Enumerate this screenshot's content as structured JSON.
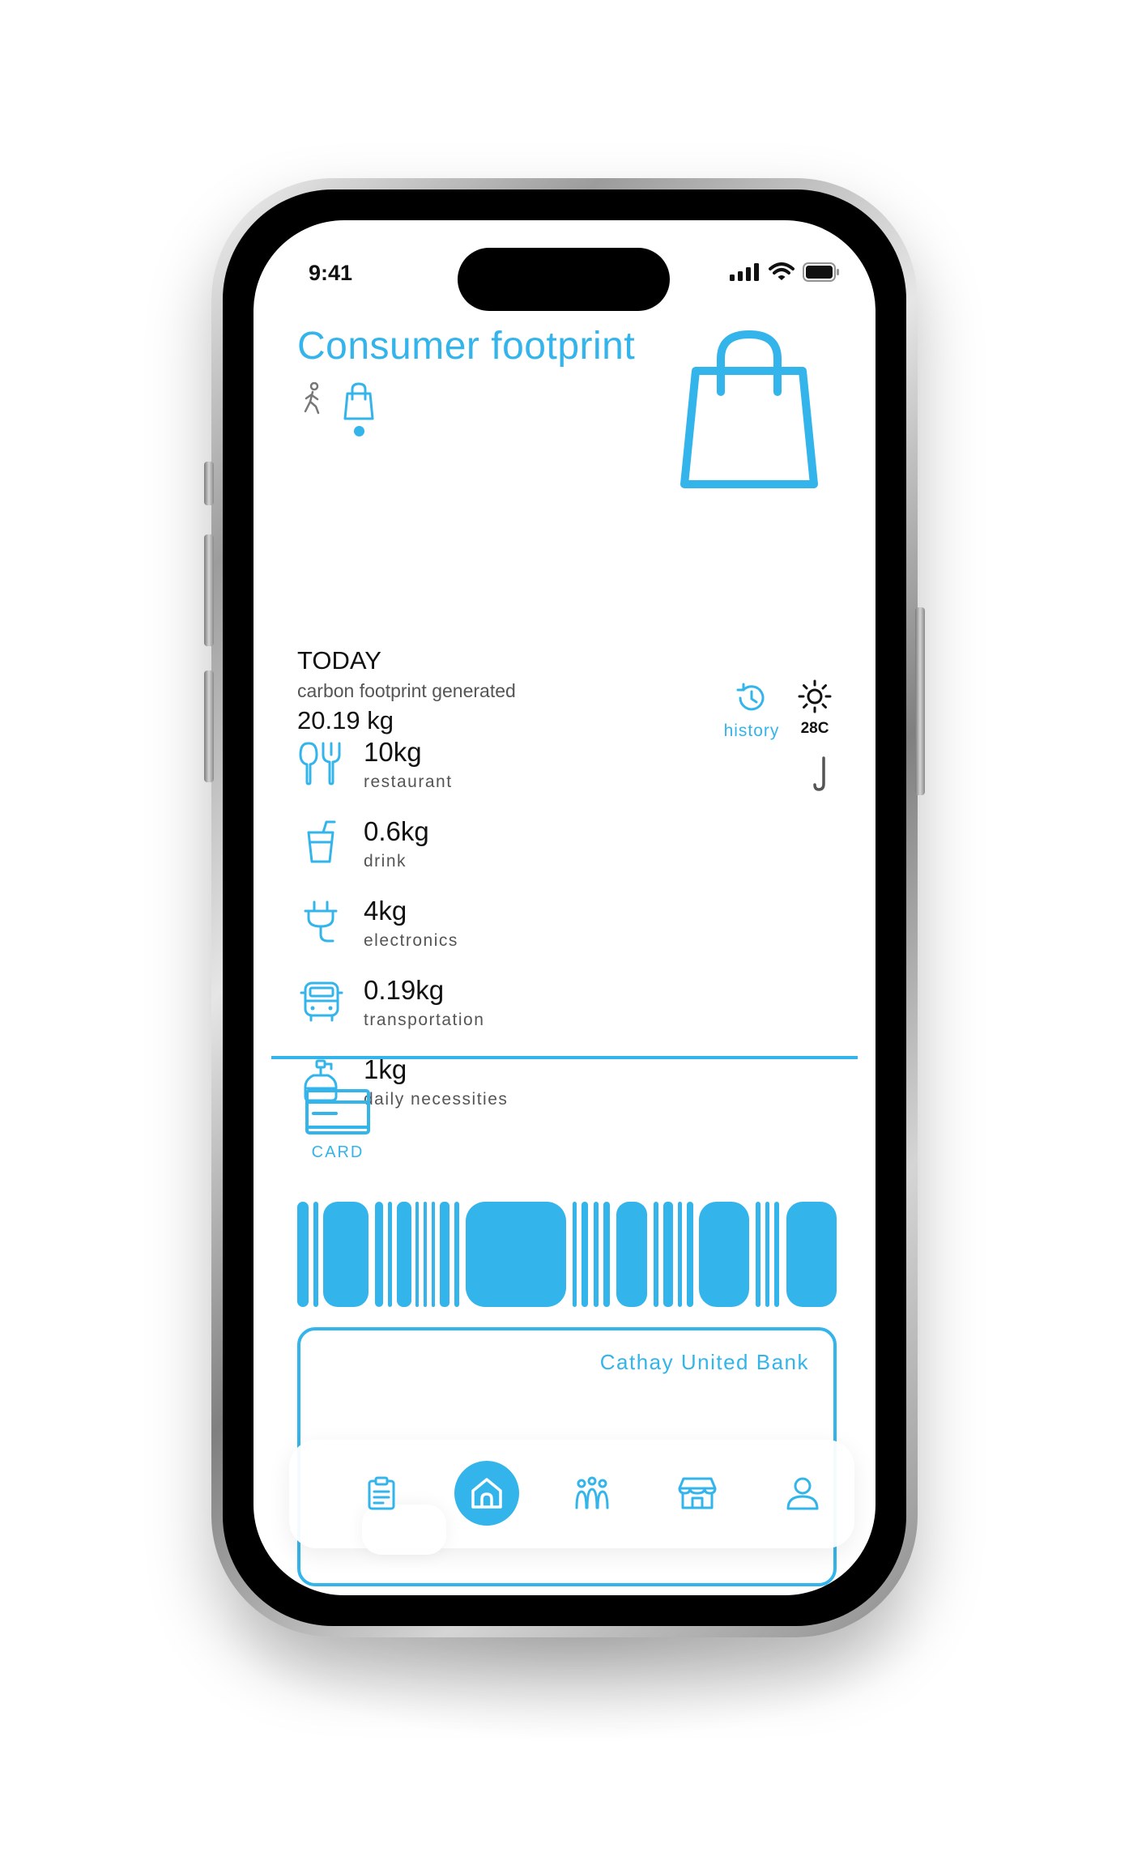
{
  "status_bar": {
    "time": "9:41"
  },
  "header": {
    "title": "Consumer footprint"
  },
  "summary": {
    "period": "TODAY",
    "subtitle": "carbon footprint generated",
    "total": "20.19 kg",
    "history_label": "history",
    "temperature": "28C"
  },
  "categories": [
    {
      "value": "10kg",
      "label": "restaurant",
      "icon": "utensils-icon"
    },
    {
      "value": "0.6kg",
      "label": "drink",
      "icon": "drink-cup-icon"
    },
    {
      "value": "4kg",
      "label": "electronics",
      "icon": "plug-icon"
    },
    {
      "value": "0.19kg",
      "label": "transportation",
      "icon": "bus-icon"
    },
    {
      "value": "1kg",
      "label": "daily necessities",
      "icon": "soap-bottle-icon"
    }
  ],
  "card": {
    "label": "CARD",
    "bank_name": "Cathay United Bank"
  },
  "nav": {
    "items": [
      "clipboard-icon",
      "home-icon",
      "community-icon",
      "store-icon",
      "profile-icon"
    ],
    "active": "home-icon"
  },
  "colors": {
    "accent": "#33b4ea",
    "text": "#111111",
    "muted": "#555555"
  }
}
